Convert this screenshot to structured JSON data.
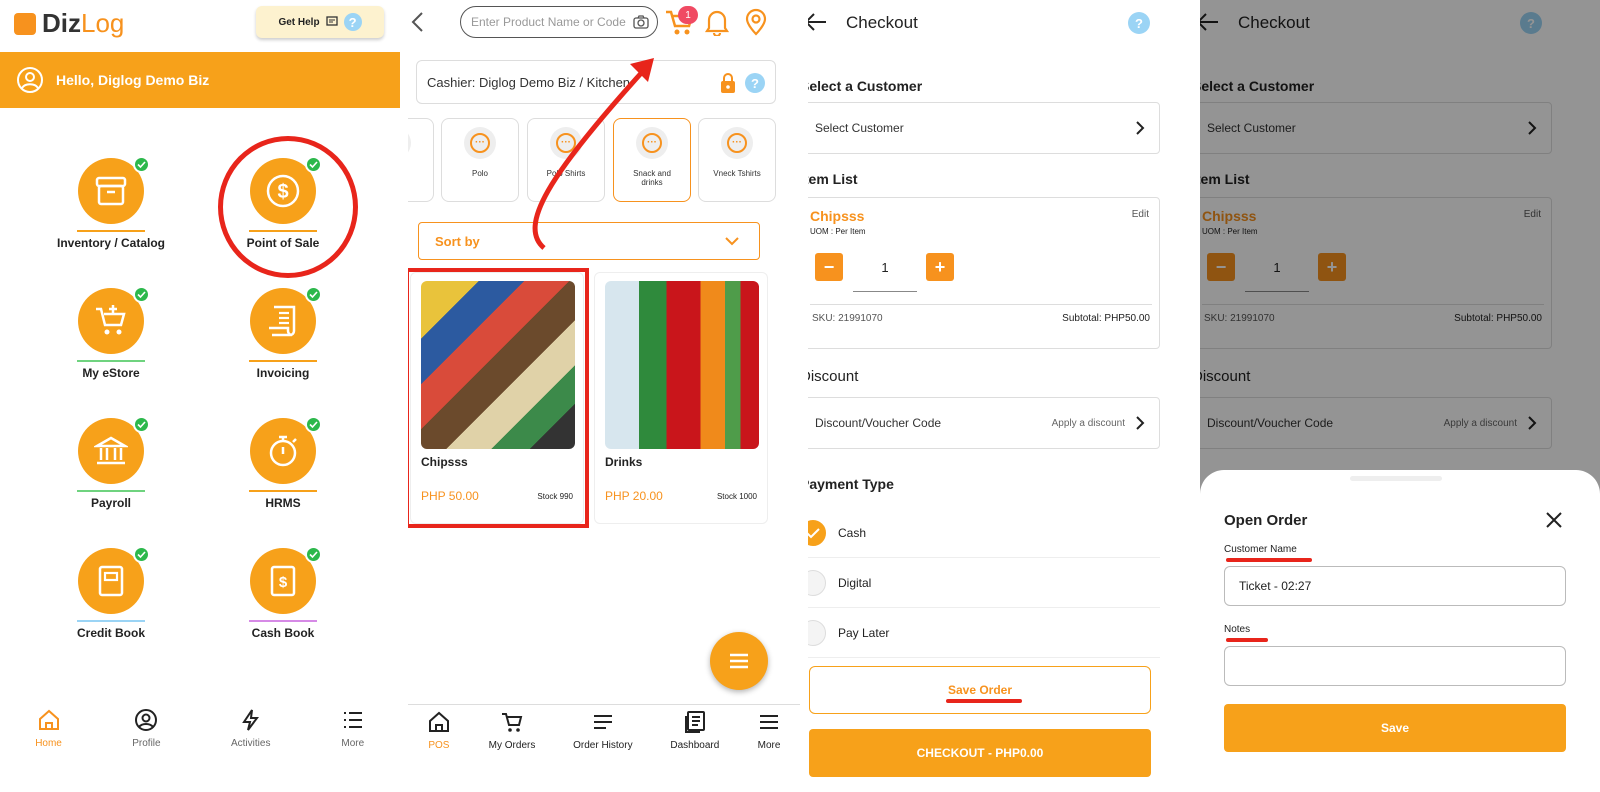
{
  "colors": {
    "accent": "#f7a11a",
    "annotation": "#e8251b",
    "success": "#2db84c"
  },
  "home": {
    "logo_part1": "Diz",
    "logo_part2": "Log",
    "get_help": "Get Help",
    "greeting": "Hello, Diglog Demo Biz",
    "tiles": [
      {
        "label": "Inventory / Catalog",
        "icon": "archive-box-icon",
        "underline": "#f7a11a"
      },
      {
        "label": "Point of Sale",
        "icon": "dollar-coin-icon",
        "underline": "#f7a11a"
      },
      {
        "label": "My eStore",
        "icon": "cart-add-icon",
        "underline": "#6fd37f"
      },
      {
        "label": "Invoicing",
        "icon": "receipt-icon",
        "underline": "#f7a11a"
      },
      {
        "label": "Payroll",
        "icon": "bank-icon",
        "underline": "#6fd37f"
      },
      {
        "label": "HRMS",
        "icon": "stopwatch-icon",
        "underline": "#f7a11a"
      },
      {
        "label": "Credit Book",
        "icon": "book-icon",
        "underline": "#9bd4f5"
      },
      {
        "label": "Cash Book",
        "icon": "cash-book-icon",
        "underline": "#d68ae6"
      }
    ],
    "nav": [
      {
        "label": "Home"
      },
      {
        "label": "Profile"
      },
      {
        "label": "Activities"
      },
      {
        "label": "More"
      }
    ]
  },
  "pos": {
    "search_placeholder": "Enter Product Name or Code",
    "cart_count": "1",
    "cashier": "Cashier: Diglog Demo Biz / Kitchen",
    "categories": [
      {
        "label": ""
      },
      {
        "label": "Polo"
      },
      {
        "label": "Polo Shirts"
      },
      {
        "label": "Snack and drinks"
      },
      {
        "label": "Vneck Tshirts"
      }
    ],
    "sort_by": "Sort by",
    "products": [
      {
        "name": "Chipsss",
        "price": "PHP 50.00",
        "stock": "Stock 990"
      },
      {
        "name": "Drinks",
        "price": "PHP 20.00",
        "stock": "Stock 1000"
      }
    ],
    "nav": [
      {
        "label": "POS"
      },
      {
        "label": "My Orders"
      },
      {
        "label": "Order History"
      },
      {
        "label": "Dashboard"
      },
      {
        "label": "More"
      }
    ]
  },
  "checkout": {
    "title": "Checkout",
    "select_customer_heading": "Select a Customer",
    "select_customer": "Select Customer",
    "item_list_heading": "Item List",
    "item": {
      "name": "Chipsss",
      "edit": "Edit",
      "uom": "UOM : Per Item",
      "qty": "1",
      "sku": "SKU: 21991070",
      "subtotal": "Subtotal: PHP50.00"
    },
    "discount_heading": "Discount",
    "discount_label": "Discount/Voucher Code",
    "discount_action": "Apply a discount",
    "payment_heading": "Payment Type",
    "payment_options": [
      {
        "label": "Cash",
        "selected": true
      },
      {
        "label": "Digital",
        "selected": false
      },
      {
        "label": "Pay Later",
        "selected": false
      }
    ],
    "save_order": "Save Order",
    "checkout_btn": "CHECKOUT - PHP0.00"
  },
  "open_order": {
    "title": "Open Order",
    "customer_name_label": "Customer Name",
    "customer_name_value": "Ticket - 02:27",
    "notes_label": "Notes",
    "notes_value": "",
    "save": "Save"
  }
}
